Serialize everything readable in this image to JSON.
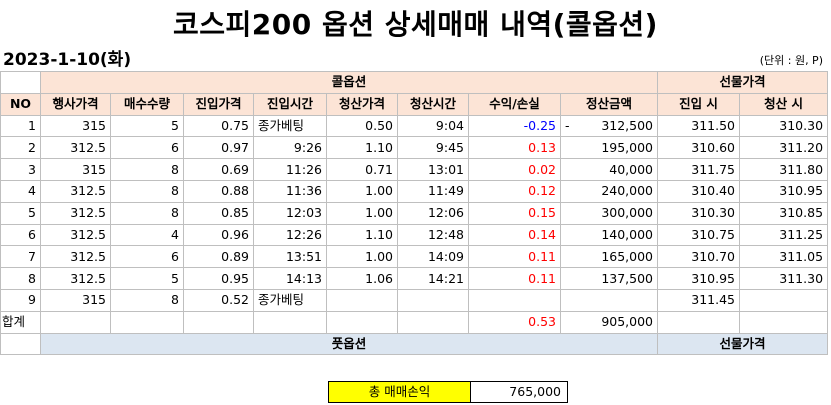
{
  "title": "코스피200 옵션 상세매매 내역(콜옵션)",
  "date": "2023-1-10(화)",
  "unit": "(단위 : 원, P)",
  "bands": {
    "call": "콜옵션",
    "futures": "선물가격",
    "put": "풋옵션",
    "futures2": "선물가격"
  },
  "headers": [
    "NO",
    "행사가격",
    "매수수량",
    "진입가격",
    "진입시간",
    "청산가격",
    "청산시간",
    "수익/손실",
    "정산금액",
    "진입 시",
    "청산 시"
  ],
  "rows": [
    {
      "no": "1",
      "strike": "315",
      "qty": "5",
      "entry": "0.75",
      "entry_time": "종가베팅",
      "exit": "0.50",
      "exit_time": "9:04",
      "pnl": "-0.25",
      "neg": "-",
      "amount": "312,500",
      "fut_in": "311.50",
      "fut_out": "310.30"
    },
    {
      "no": "2",
      "strike": "312.5",
      "qty": "6",
      "entry": "0.97",
      "entry_time": "9:26",
      "exit": "1.10",
      "exit_time": "9:45",
      "pnl": "0.13",
      "neg": "",
      "amount": "195,000",
      "fut_in": "310.60",
      "fut_out": "311.20"
    },
    {
      "no": "3",
      "strike": "315",
      "qty": "8",
      "entry": "0.69",
      "entry_time": "11:26",
      "exit": "0.71",
      "exit_time": "13:01",
      "pnl": "0.02",
      "neg": "",
      "amount": "40,000",
      "fut_in": "311.75",
      "fut_out": "311.80"
    },
    {
      "no": "4",
      "strike": "312.5",
      "qty": "8",
      "entry": "0.88",
      "entry_time": "11:36",
      "exit": "1.00",
      "exit_time": "11:49",
      "pnl": "0.12",
      "neg": "",
      "amount": "240,000",
      "fut_in": "310.40",
      "fut_out": "310.95"
    },
    {
      "no": "5",
      "strike": "312.5",
      "qty": "8",
      "entry": "0.85",
      "entry_time": "12:03",
      "exit": "1.00",
      "exit_time": "12:06",
      "pnl": "0.15",
      "neg": "",
      "amount": "300,000",
      "fut_in": "310.30",
      "fut_out": "310.85"
    },
    {
      "no": "6",
      "strike": "312.5",
      "qty": "4",
      "entry": "0.96",
      "entry_time": "12:26",
      "exit": "1.10",
      "exit_time": "12:48",
      "pnl": "0.14",
      "neg": "",
      "amount": "140,000",
      "fut_in": "310.75",
      "fut_out": "311.25"
    },
    {
      "no": "7",
      "strike": "312.5",
      "qty": "6",
      "entry": "0.89",
      "entry_time": "13:51",
      "exit": "1.00",
      "exit_time": "14:09",
      "pnl": "0.11",
      "neg": "",
      "amount": "165,000",
      "fut_in": "310.70",
      "fut_out": "311.05"
    },
    {
      "no": "8",
      "strike": "312.5",
      "qty": "5",
      "entry": "0.95",
      "entry_time": "14:13",
      "exit": "1.06",
      "exit_time": "14:21",
      "pnl": "0.11",
      "neg": "",
      "amount": "137,500",
      "fut_in": "310.95",
      "fut_out": "311.30"
    },
    {
      "no": "9",
      "strike": "315",
      "qty": "8",
      "entry": "0.52",
      "entry_time": "종가베팅",
      "exit": "",
      "exit_time": "",
      "pnl": "",
      "neg": "",
      "amount": "",
      "fut_in": "311.45",
      "fut_out": ""
    }
  ],
  "sum": {
    "label": "합계",
    "pnl": "0.53",
    "amount": "905,000"
  },
  "total": {
    "label": "총 매매손익",
    "value": "765,000"
  },
  "colors": {
    "header_bg": "#fce4d6",
    "put_bg": "#dce6f1",
    "profit": "#ff0000",
    "loss": "#0000ff",
    "total_bg": "#ffff00"
  }
}
